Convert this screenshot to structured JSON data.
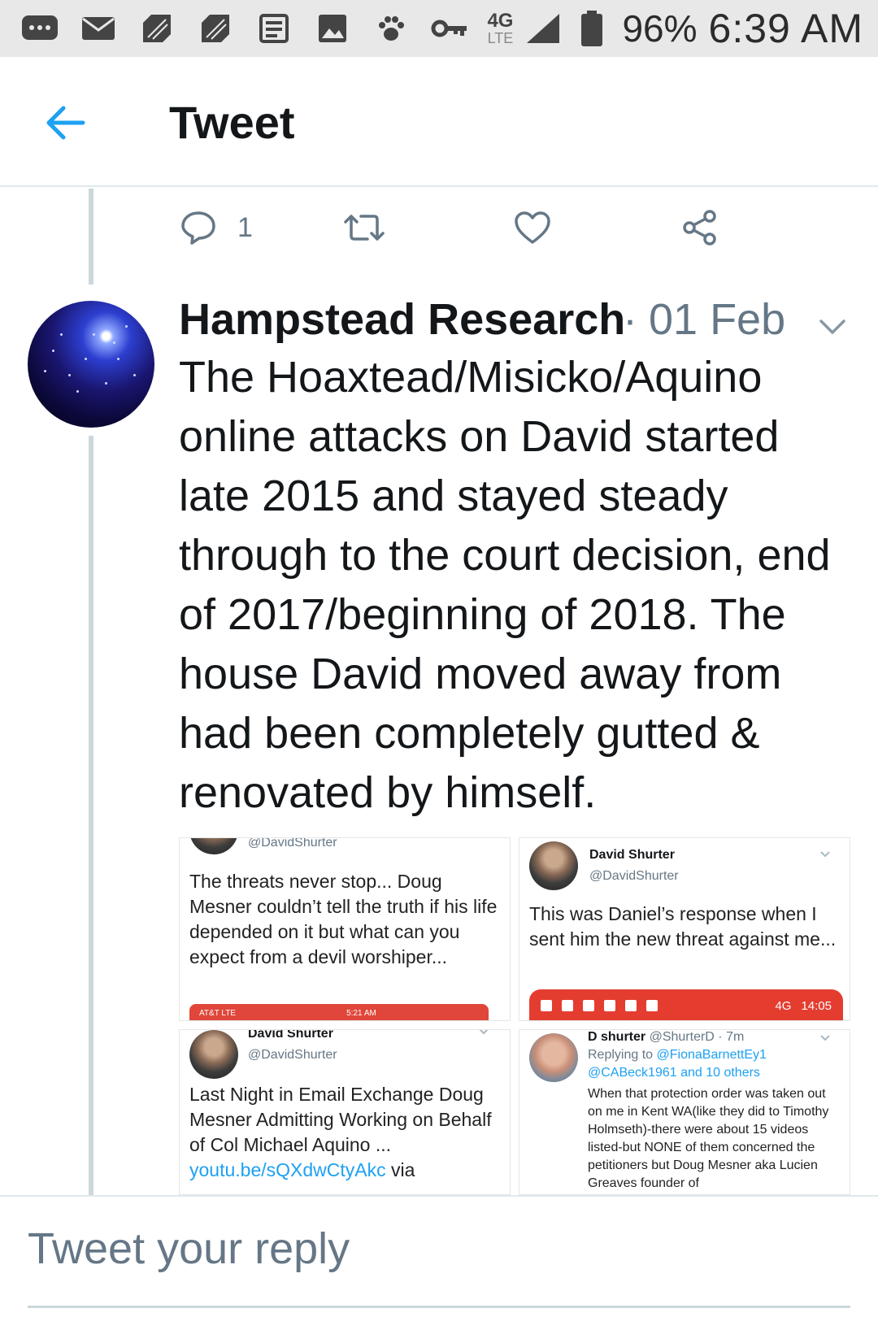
{
  "status_bar": {
    "battery": "96%",
    "time": "6:39 AM",
    "network": "4G",
    "network_sub": "LTE"
  },
  "header": {
    "title": "Tweet"
  },
  "previous_tweet_actions": {
    "reply_count": "1"
  },
  "tweet": {
    "author": "Hampstead Research",
    "separator": "·",
    "date": "01 Feb",
    "text": "The Hoaxtead/Misicko/Aquino online attacks on David started late 2015 and stayed steady through to the court decision, end of 2017/beginning of 2018. The house David moved away from had been completely gutted & renovated by himself."
  },
  "media": [
    {
      "handle": "@DavidShurter",
      "text": "The threats never stop... Doug Mesner couldn’t tell the truth if his life depended on it but what can you expect from a devil worshiper...",
      "bar_left": "AT&T LTE",
      "bar_time": "5:21 AM"
    },
    {
      "name": "David Shurter",
      "handle": "@DavidShurter",
      "text": "This was Daniel’s response when I sent him the new threat against me...",
      "bar_net": "4G",
      "bar_time": "14:05"
    },
    {
      "name": "David Shurter",
      "handle": "@DavidShurter",
      "text": "Last Night in Email Exchange Doug Mesner Admitting Working on Behalf of Col Michael Aquino ...",
      "link": "youtu.be/sQXdwCtyAkc",
      "after_link": " via"
    },
    {
      "name": "D shurter",
      "handle": "@ShurterD · 7m",
      "replying_prefix": "Replying to ",
      "replying_to": "@FionaBarnettEy1",
      "replying_more": "@CABeck1961 and 10 others",
      "text": "When that protection order was taken out on me in Kent WA(like they did to Timothy Holmseth)-there were about 15 videos listed-but NONE of them concerned the petitioners but Doug Mesner aka Lucien Greaves founder of"
    }
  ],
  "reply": {
    "placeholder": "Tweet your reply"
  },
  "colors": {
    "accent": "#1da1f2",
    "secondary_text": "#657786",
    "primary_text": "#14171a",
    "thread_line": "#ccd6dd",
    "status_bar_bg": "#e8e8e8"
  },
  "icons": {
    "back": "arrow-left-icon",
    "reply": "speech-bubble-icon",
    "retweet": "retweet-icon",
    "like": "heart-icon",
    "share": "share-icon",
    "more": "chevron-down-icon"
  }
}
